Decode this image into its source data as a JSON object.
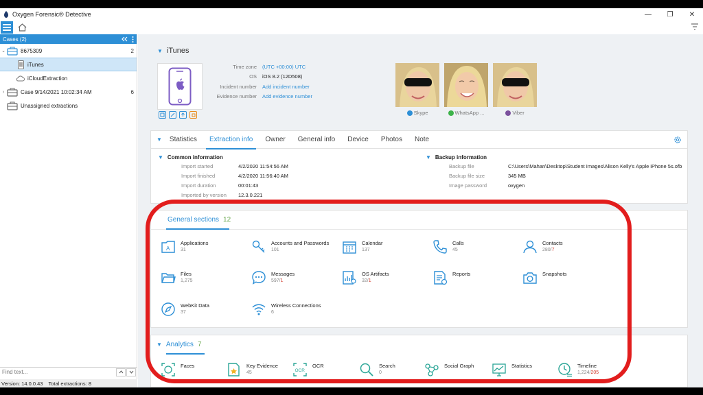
{
  "window": {
    "title": "Oxygen Forensic® Detective",
    "minimize": "—",
    "maximize": "❐",
    "close": "✕"
  },
  "sidebar": {
    "header": "Cases (2)",
    "tree": [
      {
        "label": "8675309",
        "count": "2",
        "arrow": "⌄",
        "icon": "briefcase-icon"
      },
      {
        "label": "iTunes",
        "count": "",
        "arrow": "",
        "icon": "phone-icon",
        "selected": true
      },
      {
        "label": "iCloudExtraction",
        "count": "",
        "arrow": "",
        "icon": "cloud-icon"
      },
      {
        "label": "Case 9/14/2021 10:02:34 AM",
        "count": "6",
        "arrow": "›",
        "icon": "briefcase-icon"
      },
      {
        "label": "Unassigned extractions",
        "count": "",
        "arrow": "",
        "icon": "briefcase-icon"
      }
    ],
    "find_placeholder": "Find text...",
    "status_version": "Version: 14.0.0.43",
    "status_total": "Total extractions: 8"
  },
  "device": {
    "section_title": "iTunes",
    "meta": [
      {
        "label": "Time zone",
        "value": "(UTC +00:00) UTC",
        "link": true
      },
      {
        "label": "OS",
        "value": "iOS 8.2 (12D508)",
        "link": false
      },
      {
        "label": "Incident number",
        "value": "Add incident number",
        "link": true
      },
      {
        "label": "Evidence number",
        "value": "Add evidence number",
        "link": true
      }
    ],
    "contacts": [
      {
        "service": "Skype",
        "color": "#2d8fd6"
      },
      {
        "service": "WhatsApp ...",
        "color": "#3db34a"
      },
      {
        "service": "Viber",
        "color": "#7b519d"
      }
    ]
  },
  "info_tabs": {
    "tabs": [
      "Statistics",
      "Extraction info",
      "Owner",
      "General info",
      "Device",
      "Photos",
      "Note"
    ],
    "active": 1,
    "common": {
      "heading": "Common information",
      "rows": [
        {
          "label": "Import started",
          "value": "4/2/2020 11:54:56 AM"
        },
        {
          "label": "Import finished",
          "value": "4/2/2020 11:56:40 AM"
        },
        {
          "label": "Import duration",
          "value": "00:01:43"
        },
        {
          "label": "Imported by version",
          "value": "12.3.0.221"
        }
      ]
    },
    "backup": {
      "heading": "Backup information",
      "rows": [
        {
          "label": "Backup file",
          "value": "C:\\Users\\Mahan\\Desktop\\Student Images\\Alison Kelly's Apple iPhone 5s.ofb"
        },
        {
          "label": "Backup file size",
          "value": "345 MB"
        },
        {
          "label": "Image password",
          "value": "oxygen"
        }
      ]
    }
  },
  "general_sections": {
    "title": "General sections",
    "count": "12",
    "items": [
      {
        "name": "Applications",
        "count": "31",
        "red": "",
        "icon": "applications-icon"
      },
      {
        "name": "Accounts and Passwords",
        "count": "101",
        "red": "",
        "icon": "key-icon"
      },
      {
        "name": "Calendar",
        "count": "137",
        "red": "",
        "icon": "calendar-icon"
      },
      {
        "name": "Calls",
        "count": "45",
        "red": "",
        "icon": "phone-call-icon"
      },
      {
        "name": "Contacts",
        "count": "280/",
        "red": "7",
        "icon": "contact-person-icon"
      },
      {
        "name": "Files",
        "count": "1,275",
        "red": "",
        "icon": "folder-icon"
      },
      {
        "name": "Messages",
        "count": "597/",
        "red": "1",
        "icon": "chat-bubble-icon"
      },
      {
        "name": "OS Artifacts",
        "count": "32/",
        "red": "1",
        "icon": "os-artifacts-icon"
      },
      {
        "name": "Reports",
        "count": "",
        "red": "",
        "icon": "report-icon"
      },
      {
        "name": "Snapshots",
        "count": "",
        "red": "",
        "icon": "camera-icon"
      },
      {
        "name": "WebKit Data",
        "count": "37",
        "red": "",
        "icon": "compass-icon"
      },
      {
        "name": "Wireless Connections",
        "count": "6",
        "red": "",
        "icon": "wifi-icon"
      }
    ]
  },
  "analytics": {
    "title": "Analytics",
    "count": "7",
    "items": [
      {
        "name": "Faces",
        "count": "",
        "red": "",
        "icon": "face-scan-icon"
      },
      {
        "name": "Key Evidence",
        "count": "45",
        "red": "",
        "icon": "key-evidence-icon"
      },
      {
        "name": "OCR",
        "count": "",
        "red": "",
        "icon": "ocr-icon"
      },
      {
        "name": "Search",
        "count": "0",
        "red": "",
        "icon": "search-icon"
      },
      {
        "name": "Social Graph",
        "count": "",
        "red": "",
        "icon": "social-graph-icon"
      },
      {
        "name": "Statistics",
        "count": "",
        "red": "",
        "icon": "statistics-icon"
      },
      {
        "name": "Timeline",
        "count": "1,224/",
        "red": "205",
        "icon": "timeline-icon"
      }
    ]
  },
  "colors": {
    "accent": "#2d8fd6",
    "count_green": "#6aa84f",
    "highlight_red": "#d23a2b",
    "annotation_red": "#e21d1d"
  }
}
